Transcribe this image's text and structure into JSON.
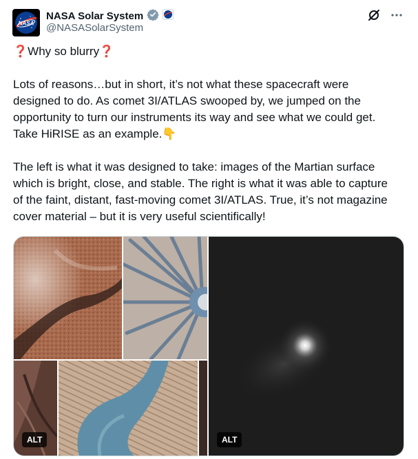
{
  "account": {
    "display_name": "NASA Solar System",
    "handle": "@NASASolarSystem",
    "avatar_text": "NASA"
  },
  "post": {
    "lines": [
      "❓Why so blurry❓",
      "Lots of reasons…but in short, it’s not what these spacecraft were designed to do. As comet 3I/ATLAS swooped by, we jumped on the opportunity to turn our instruments its way and see what we could get. Take HiRISE as an example.👇",
      "The left is what it was designed to take: images of the Martian surface which is bright, close, and stable. The right is what it was able to capture of the faint, distant, fast-moving comet 3I/ATLAS. True, it’s not magazine cover material – but it is very useful scientifically!"
    ]
  },
  "media": {
    "left_alt_badge": "ALT",
    "right_alt_badge": "ALT"
  },
  "icons": {
    "verified": "verified-badge-icon",
    "affiliate": "nasa-affiliate-icon",
    "grok": "grok-icon",
    "more": "more-options-icon"
  },
  "colors": {
    "verified_gray": "#829aab",
    "text": "#0f1419",
    "secondary": "#536471"
  }
}
